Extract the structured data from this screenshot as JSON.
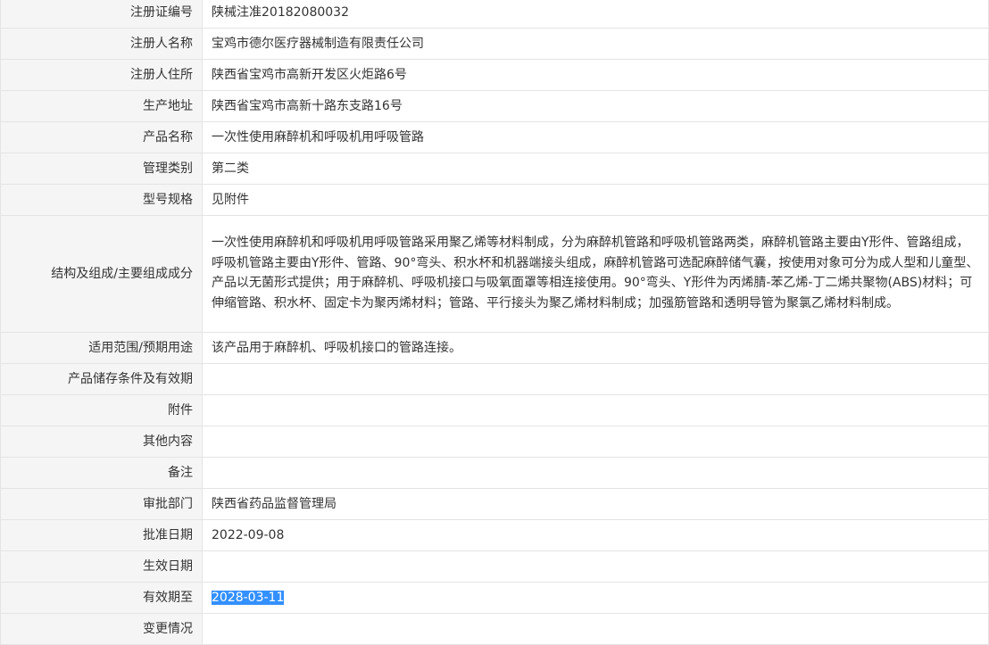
{
  "rows": [
    {
      "label": "注册证编号",
      "value": "陕械注准20182080032"
    },
    {
      "label": "注册人名称",
      "value": "宝鸡市德尔医疗器械制造有限责任公司"
    },
    {
      "label": "注册人住所",
      "value": "陕西省宝鸡市高新开发区火炬路6号"
    },
    {
      "label": "生产地址",
      "value": "陕西省宝鸡市高新十路东支路16号"
    },
    {
      "label": "产品名称",
      "value": "一次性使用麻醉机和呼吸机用呼吸管路"
    },
    {
      "label": "管理类别",
      "value": "第二类"
    },
    {
      "label": "型号规格",
      "value": "见附件"
    },
    {
      "label": "结构及组成/主要组成成分",
      "value": "一次性使用麻醉机和呼吸机用呼吸管路采用聚乙烯等材料制成，分为麻醉机管路和呼吸机管路两类，麻醉机管路主要由Y形件、管路组成，呼吸机管路主要由Y形件、管路、90°弯头、积水杯和机器端接头组成，麻醉机管路可选配麻醉储气囊，按使用对象可分为成人型和儿童型、产品以无菌形式提供；用于麻醉机、呼吸机接口与吸氧面罩等相连接使用。90°弯头、Y形件为丙烯腈-苯乙烯-丁二烯共聚物(ABS)材料；可伸缩管路、积水杯、固定卡为聚丙烯材料；管路、平行接头为聚乙烯材料制成；加强筋管路和透明导管为聚氯乙烯材料制成。"
    },
    {
      "label": "适用范围/预期用途",
      "value": "该产品用于麻醉机、呼吸机接口的管路连接。"
    },
    {
      "label": "产品储存条件及有效期",
      "value": ""
    },
    {
      "label": "附件",
      "value": ""
    },
    {
      "label": "其他内容",
      "value": ""
    },
    {
      "label": "备注",
      "value": ""
    },
    {
      "label": "审批部门",
      "value": "陕西省药品监督管理局"
    },
    {
      "label": "批准日期",
      "value": "2022-09-08"
    },
    {
      "label": "生效日期",
      "value": ""
    },
    {
      "label": "有效期至",
      "value": "2028-03-11",
      "selected": true
    },
    {
      "label": "变更情况",
      "value": ""
    }
  ],
  "colors": {
    "label_background": "#f5f5f5",
    "border": "#e4e4e4",
    "selection": "#3390ff"
  }
}
